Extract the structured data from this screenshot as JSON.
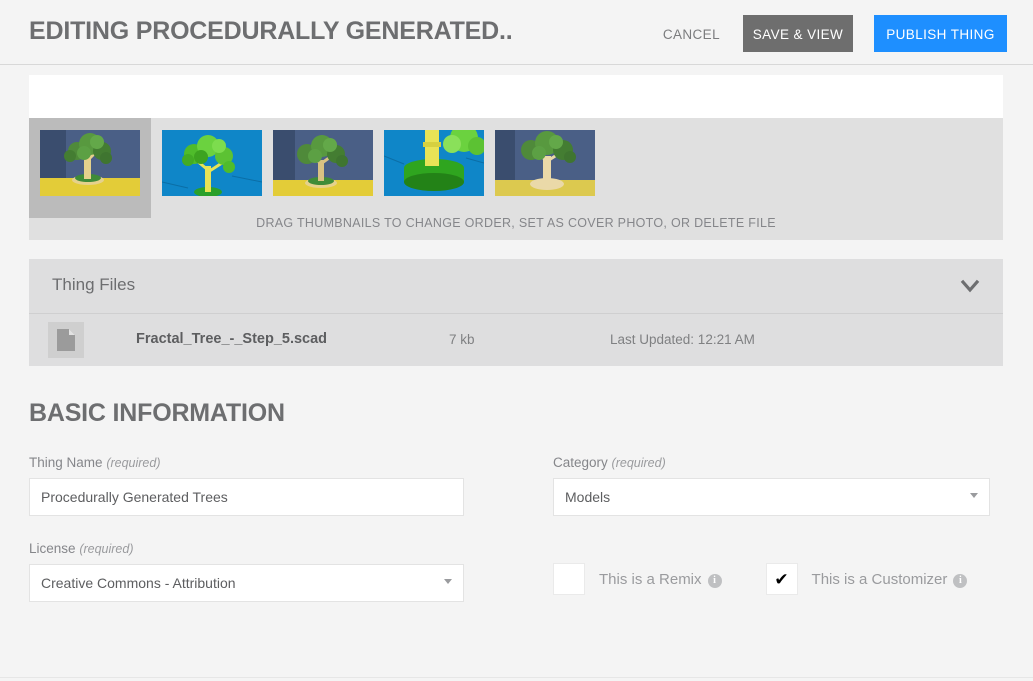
{
  "header": {
    "title": "EDITING PROCEDURALLY GENERATED..",
    "cancel_label": "CANCEL",
    "save_label": "SAVE & VIEW",
    "publish_label": "PUBLISH THING",
    "publish_color": "#1e8fff",
    "save_color": "#6e6e6e"
  },
  "gallery": {
    "caption": "DRAG THUMBNAILS TO CHANGE ORDER, SET AS COVER PHOTO, OR DELETE FILE",
    "thumbnails": [
      {
        "name": "thumbnail-1",
        "cover": true,
        "background": "#4a5f86",
        "ground": "#e8d23c",
        "trunk": "#e5d18c",
        "canopy": "#4f8a3a"
      },
      {
        "name": "thumbnail-2",
        "cover": false,
        "background": "#0f86c8",
        "ground": "#0f86c8",
        "trunk": "#e8e356",
        "canopy": "#5fc232"
      },
      {
        "name": "thumbnail-3",
        "cover": false,
        "background": "#4a5f86",
        "ground": "#e8d23c",
        "trunk": "#e5d18c",
        "canopy": "#4f8a3a"
      },
      {
        "name": "thumbnail-4",
        "cover": false,
        "background": "#0f86c8",
        "ground": "#2aa02a",
        "trunk": "#e8e356",
        "canopy": "#5fc232"
      },
      {
        "name": "thumbnail-5",
        "cover": false,
        "background": "#4a5f86",
        "ground": "#e8d23c",
        "trunk": "#ead9a8",
        "canopy": "#4f8a3a"
      }
    ]
  },
  "thing_files": {
    "panel_title": "Thing Files",
    "collapse_icon": "chevron-down-icon",
    "columns": [
      "name",
      "size",
      "updated"
    ],
    "rows": [
      {
        "icon": "file-icon",
        "name": "Fractal_Tree_-_Step_5.scad",
        "size": "7 kb",
        "updated": "Last Updated: 12:21 AM"
      }
    ]
  },
  "basic_information": {
    "section_title": "BASIC INFORMATION",
    "thing_name": {
      "label": "Thing Name",
      "required_note": "(required)",
      "value": "Procedurally Generated Trees",
      "placeholder": "Thing Name"
    },
    "category": {
      "label": "Category",
      "required_note": "(required)",
      "value": "Models"
    },
    "license": {
      "label": "License",
      "required_note": "(required)",
      "value": "Creative Commons - Attribution"
    },
    "checkboxes": [
      {
        "name": "remix",
        "label": "This is a Remix",
        "checked": false,
        "mark": "",
        "info": "i"
      },
      {
        "name": "customizer",
        "label": "This is a Customizer",
        "checked": true,
        "mark": "✔",
        "info": "i"
      }
    ]
  }
}
